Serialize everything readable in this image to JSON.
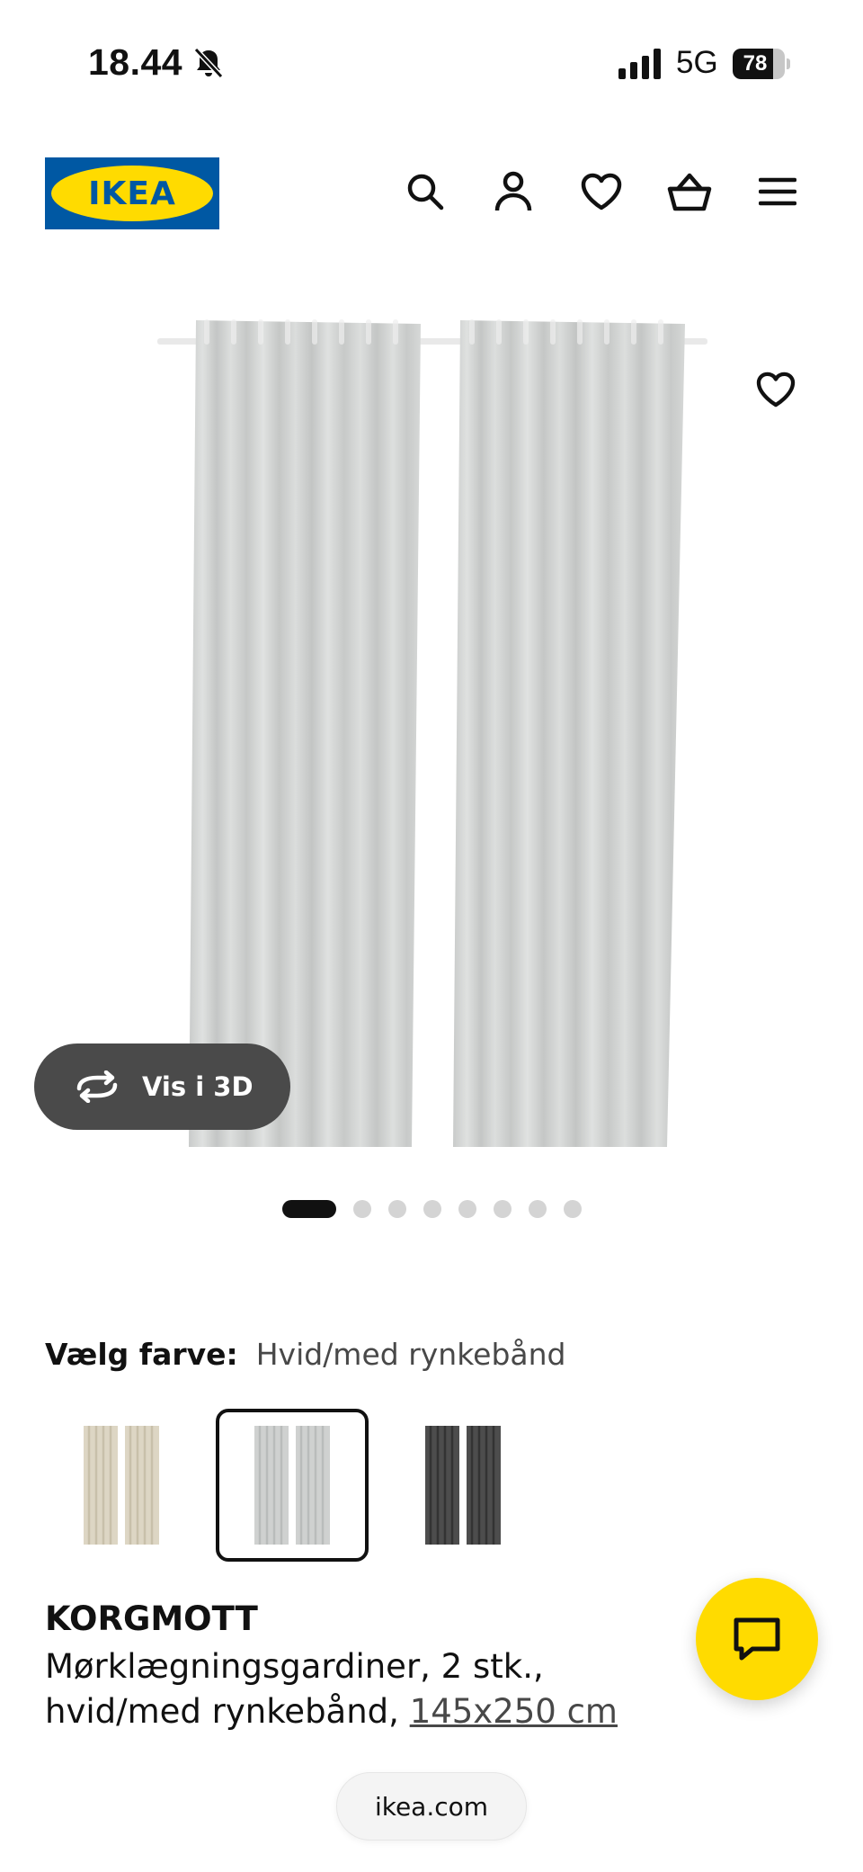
{
  "status_bar": {
    "time": "18.44",
    "network": "5G",
    "battery": "78",
    "battery_level": 0.78
  },
  "header": {
    "logo_text": "IKEA",
    "icons": [
      "search-icon",
      "account-icon",
      "favourites-icon",
      "basket-icon",
      "menu-icon"
    ]
  },
  "gallery": {
    "view_3d_label": "Vis i 3D",
    "image_count": 8,
    "active_index": 0
  },
  "colors": {
    "label": "Vælg farve:",
    "selected_value": "Hvid/med rynkebånd",
    "swatches": [
      {
        "name": "beige",
        "fabric": "#ddd6c4",
        "fold": "#c8c0aa"
      },
      {
        "name": "hvid",
        "fabric": "#cfd1d0",
        "fold": "#b9bcbb"
      },
      {
        "name": "mørkegrå",
        "fabric": "#4d4d4d",
        "fold": "#333333"
      }
    ],
    "selected_index": 1
  },
  "product": {
    "name": "KORGMOTT",
    "description": "Mørklægningsgardiner, 2 stk., hvid/med rynkebånd, ",
    "size": "145x250 cm"
  },
  "browser": {
    "url": "ikea.com"
  },
  "theme": {
    "ikea_blue": "#0058a3",
    "ikea_yellow": "#ffdb00",
    "curtain": "#d3d5d4"
  }
}
